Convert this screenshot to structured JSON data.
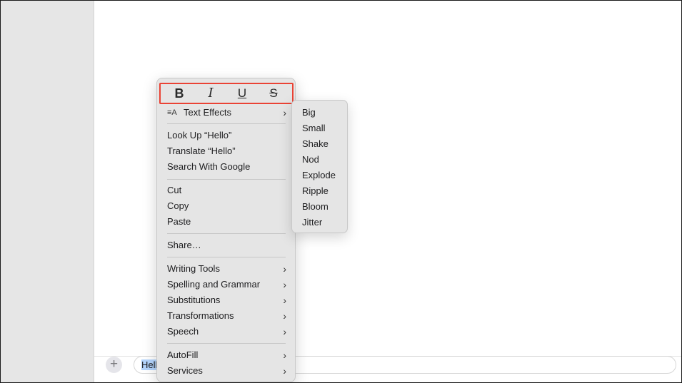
{
  "compose": {
    "add_icon": "+",
    "input_selected_text": "Hell"
  },
  "format_bar": {
    "bold": "B",
    "italic": "I",
    "underline": "U",
    "strikethrough": "S"
  },
  "menu": {
    "text_effects": {
      "icon": "≡A",
      "label": "Text Effects"
    },
    "lookup_label": "Look Up “Hello”",
    "translate_label": "Translate “Hello”",
    "search_label": "Search With Google",
    "cut_label": "Cut",
    "copy_label": "Copy",
    "paste_label": "Paste",
    "share_label": "Share…",
    "writing_tools_label": "Writing Tools",
    "spelling_label": "Spelling and Grammar",
    "substitutions_label": "Substitutions",
    "transformations_label": "Transformations",
    "speech_label": "Speech",
    "autofill_label": "AutoFill",
    "services_label": "Services",
    "chevron": "›"
  },
  "submenu": {
    "items": [
      "Big",
      "Small",
      "Shake",
      "Nod",
      "Explode",
      "Ripple",
      "Bloom",
      "Jitter"
    ]
  },
  "colors": {
    "highlight_border": "#ea4335",
    "selection": "#b3d4fc",
    "menu_bg": "#e5e5e5"
  }
}
